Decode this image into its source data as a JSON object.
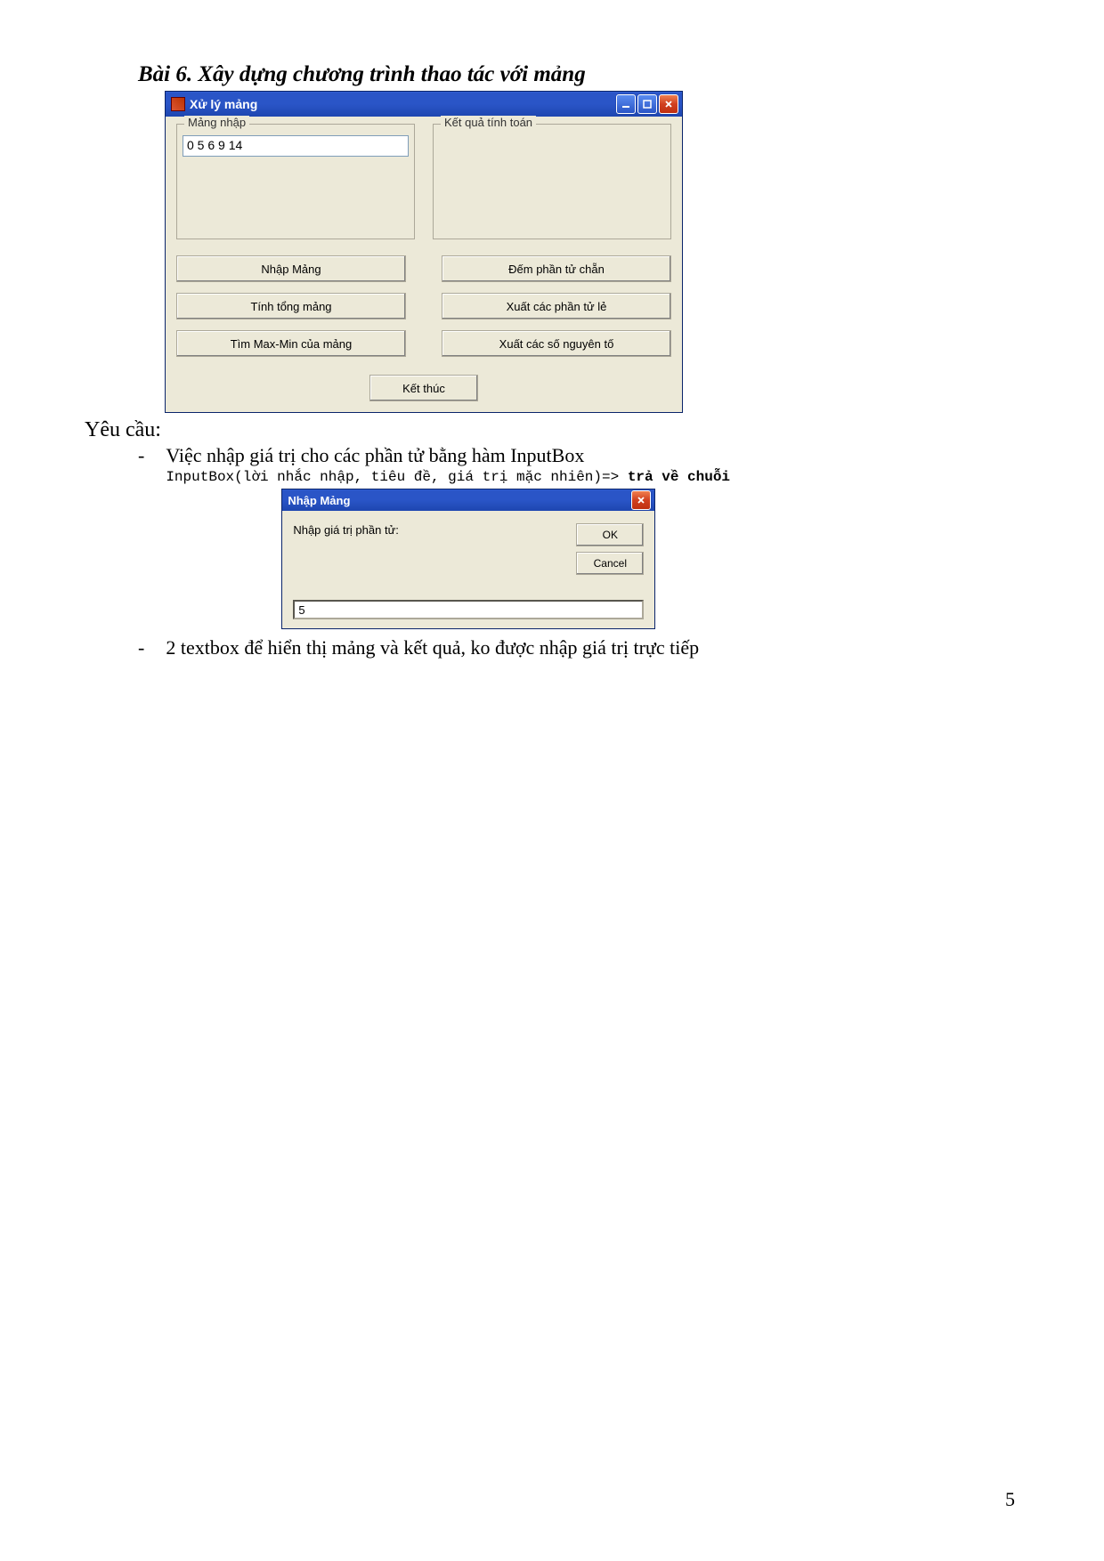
{
  "heading": "Bài 6. Xây dựng chương trình thao tác với mảng",
  "window1": {
    "title": "Xử lý mảng",
    "groups": {
      "input_label": "Mảng nhập",
      "input_value": "0 5 6 9 14",
      "output_label": "Kết quả tính toán"
    },
    "buttons": {
      "enter": "Nhập Mảng",
      "count_even": "Đếm phần tử chẵn",
      "sum": "Tính tổng mảng",
      "out_odd": "Xuất các phần tử lẻ",
      "maxmin": "Tìm Max-Min của mảng",
      "out_primes": "Xuất các số nguyên tố",
      "finish": "Kết thúc"
    }
  },
  "requirements_label": "Yêu cầu:",
  "req1_text": "Việc  nhập giá trị cho các phần tử bằng hàm InputBox",
  "code_line_a": "InputBox(lời nhắc nhập, tiêu đề, giá trị mặc nhiên)=> ",
  "code_line_b": "trả về chuỗi",
  "window2": {
    "title": "Nhập Mảng",
    "prompt": "Nhập giá trị phần tử:",
    "ok": "OK",
    "cancel": "Cancel",
    "value": "5"
  },
  "req2_text": "2 textbox để hiển thị mảng và kết quả, ko được nhập giá trị trực tiếp",
  "page_number": "5"
}
